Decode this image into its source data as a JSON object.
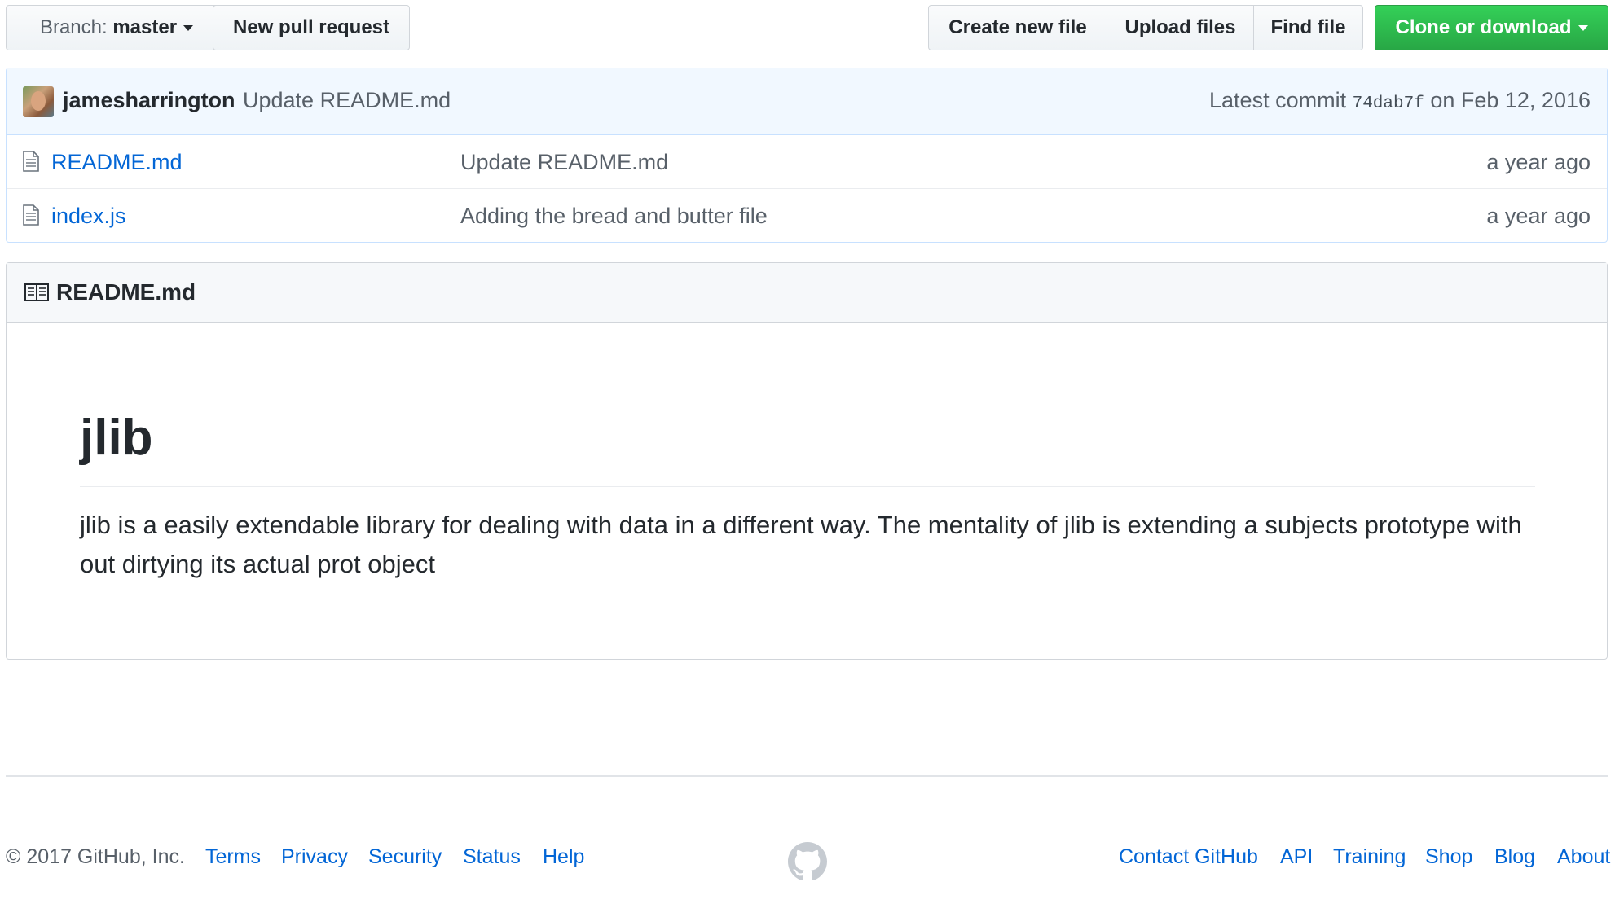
{
  "toolbar": {
    "branch_prefix": "Branch:",
    "branch_name": "master",
    "new_pull_request": "New pull request",
    "create_new_file": "Create new file",
    "upload_files": "Upload files",
    "find_file": "Find file",
    "clone_or_download": "Clone or download",
    "clone_color": "#28a745"
  },
  "commit": {
    "author": "jamesharrington",
    "message": "Update README.md",
    "latest_prefix": "Latest commit",
    "sha": "74dab7f",
    "date_text": "on Feb 12, 2016"
  },
  "files": [
    {
      "name": "README.md",
      "message": "Update README.md",
      "age": "a year ago",
      "icon": "file-icon"
    },
    {
      "name": "index.js",
      "message": "Adding the bread and butter file",
      "age": "a year ago",
      "icon": "file-icon"
    }
  ],
  "readme": {
    "header_title": "README.md",
    "header_icon": "book-icon",
    "heading": "jlib",
    "body": "jlib is a easily extendable library for dealing with data in a different way. The mentality of jlib is extending a subjects prototype with out dirtying its actual prot object"
  },
  "footer": {
    "copyright": "© 2017 GitHub, Inc.",
    "left_links": [
      "Terms",
      "Privacy",
      "Security",
      "Status",
      "Help"
    ],
    "right_links": [
      "Contact GitHub",
      "API",
      "Training",
      "Shop",
      "Blog",
      "About"
    ],
    "logo_icon": "github-octocat-icon",
    "link_color": "#0366d6"
  }
}
